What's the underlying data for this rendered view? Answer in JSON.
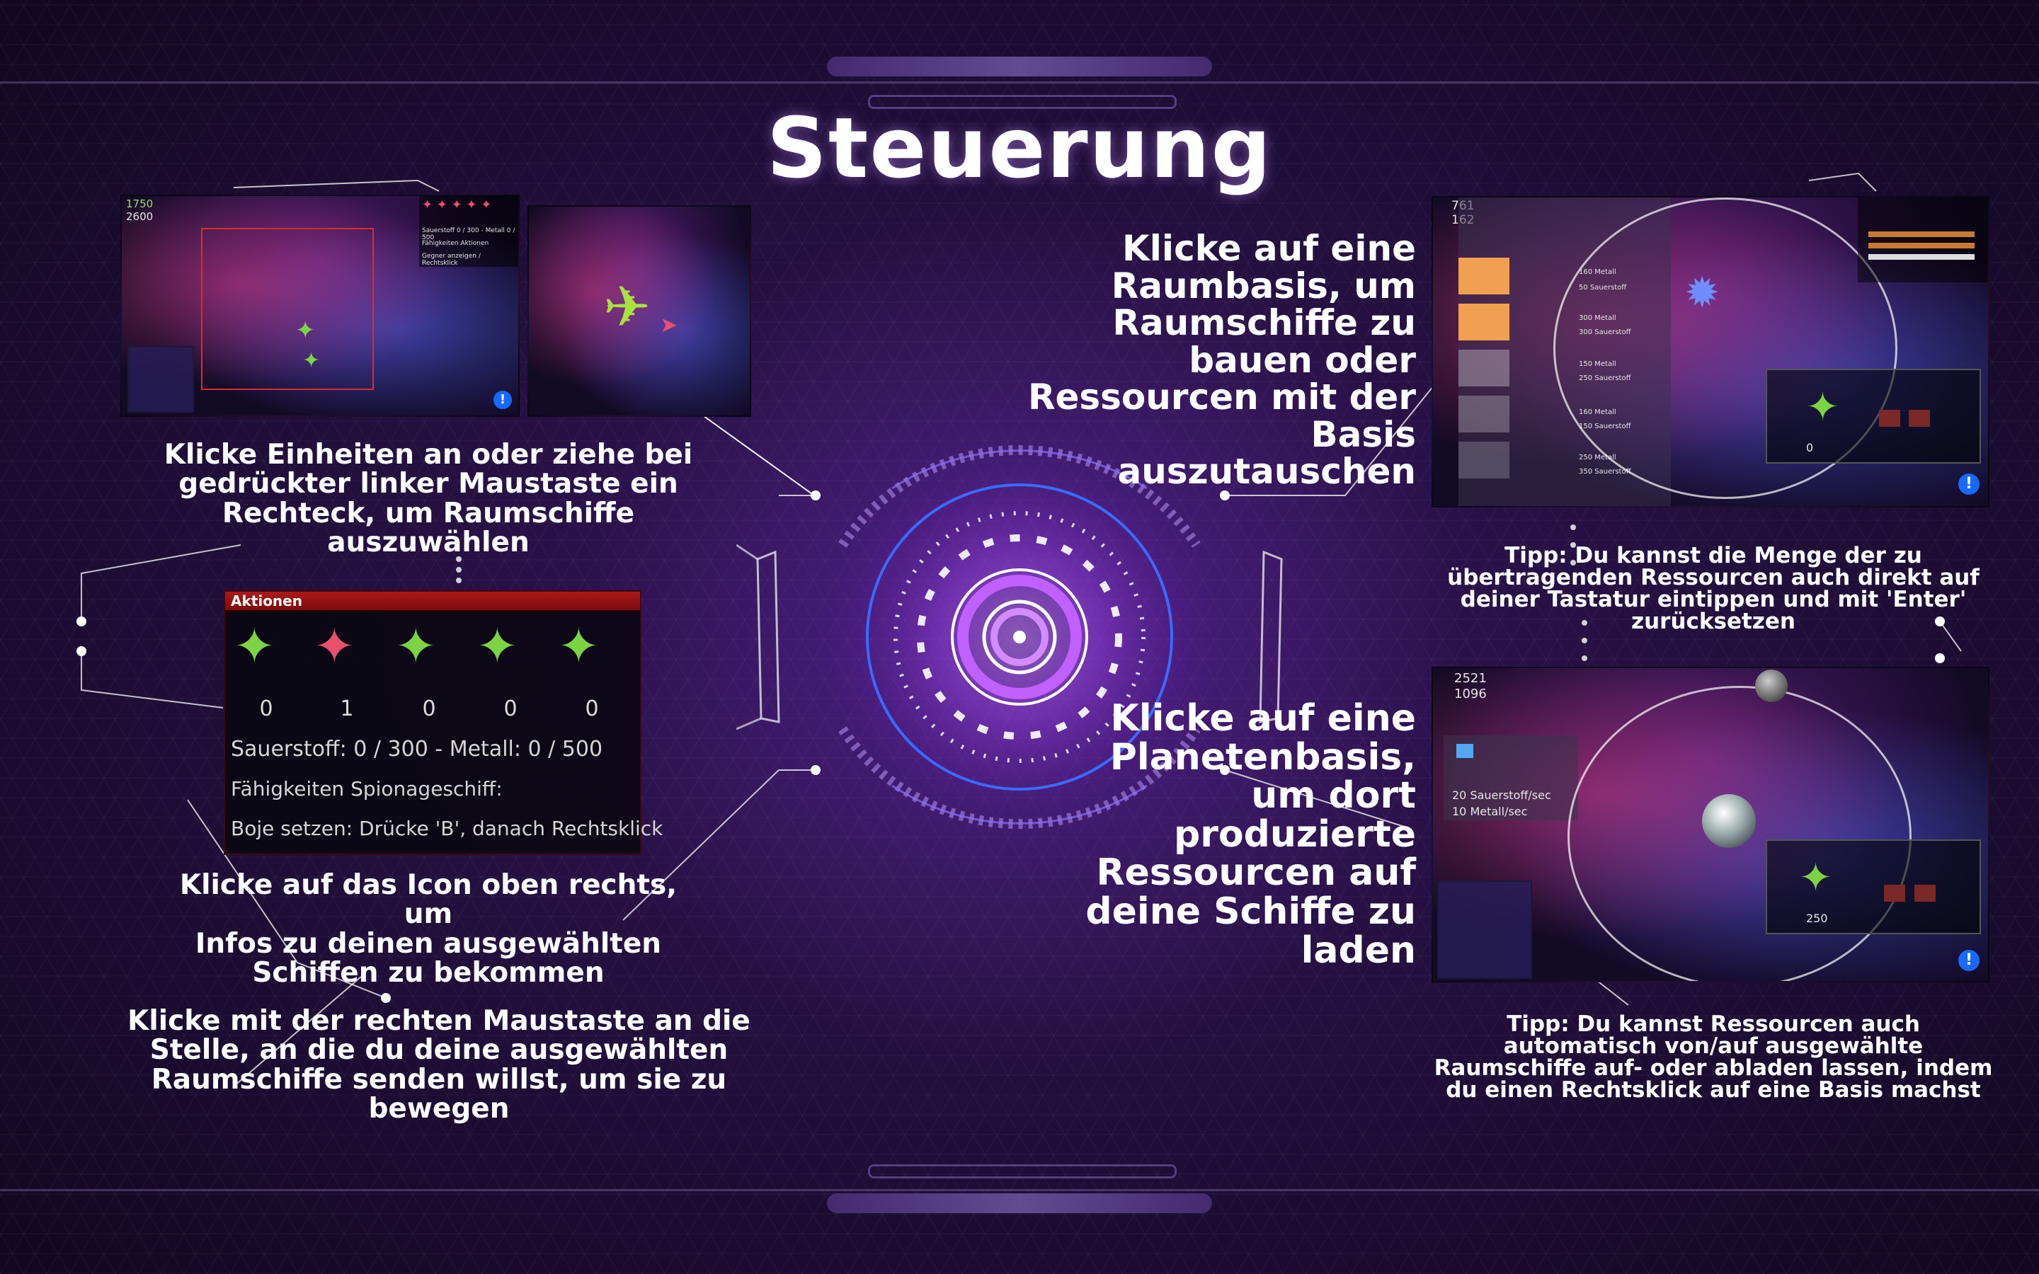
{
  "title": "Steuerung",
  "captions": {
    "select": [
      "Klicke Einheiten an oder ziehe bei",
      "gedrückter linker Maustaste ein",
      "Rechteck, um Raumschiffe",
      "auszuwählen"
    ],
    "info_icon": [
      "Klicke auf das Icon oben rechts, um",
      "Infos zu deinen ausgewählten",
      "Schiffen zu bekommen"
    ],
    "move": [
      "Klicke mit der rechten Maustaste an die",
      "Stelle, an die du deine ausgewählten",
      "Raumschiffe senden willst, um sie zu",
      "bewegen"
    ],
    "spacebase": [
      "Klicke auf eine",
      "Raumbasis, um",
      "Raumschiffe zu",
      "bauen oder",
      "Ressourcen mit der",
      "Basis",
      "auszutauschen"
    ],
    "planetbase": [
      "Klicke auf eine",
      "Planetenbasis,",
      "um dort",
      "produzierte",
      "Ressourcen auf",
      "deine Schiffe zu",
      "laden"
    ],
    "tip1": [
      "Tipp: Du kannst die Menge der zu",
      "übertragenden Ressourcen auch direkt auf",
      "deiner Tastatur eintippen und mit 'Enter'",
      "zurücksetzen"
    ],
    "tip2": [
      "Tipp: Du kannst Ressourcen auch",
      "automatisch von/auf ausgewählte",
      "Raumschiffe auf- oder abladen lassen, indem",
      "du einen Rechtsklick auf eine Basis machst"
    ]
  },
  "shot1": {
    "res1": "1750",
    "res2": "2600",
    "panel_line1": "Sauerstoff 0 / 300 - Metall 0 / 500",
    "panel_line2": "Fähigkeiten Aktionen",
    "panel_line3": "Gegner anzeigen / Rechtsklick"
  },
  "actions": {
    "header": "Aktionen",
    "counts": [
      "0",
      "1",
      "0",
      "0",
      "0"
    ],
    "resources": "Sauerstoff: 0 / 300  -  Metall: 0 / 500",
    "abilities": "Fähigkeiten Spionageschiff:",
    "buoy": "Boje setzen: Drücke 'B', danach Rechtsklick"
  },
  "shot3": {
    "res1": "761",
    "res2": "162",
    "rows": [
      [
        "160 Metall",
        "50 Sauerstoff"
      ],
      [
        "300 Metall",
        "300 Sauerstoff"
      ],
      [
        "150 Metall",
        "250 Sauerstoff"
      ],
      [
        "160 Metall",
        "150 Sauerstoff"
      ],
      [
        "250 Metall",
        "350 Sauerstoff"
      ]
    ],
    "bottom_count": "0"
  },
  "shot4": {
    "res1": "2521",
    "res2": "1096",
    "rate1": "20 Sauerstoff/sec",
    "rate2": "10 Metall/sec",
    "bottom_count": "250"
  },
  "colors": {
    "accent": "#8a3cff",
    "ship_green": "#7cd343",
    "ship_red": "#e8506e",
    "info_blue": "#1769ff",
    "panel_red": "#b01818"
  }
}
